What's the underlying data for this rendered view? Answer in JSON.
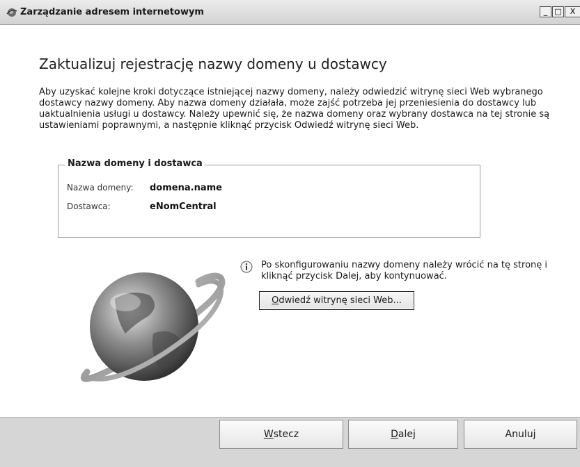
{
  "window": {
    "title": "Zarządzanie adresem internetowym",
    "controls": {
      "minimize": "_",
      "maximize": "□",
      "close": "X"
    }
  },
  "main": {
    "heading": "Zaktualizuj rejestrację nazwy domeny u dostawcy",
    "description": "Aby uzyskać kolejne kroki dotyczące istniejącej nazwy domeny, należy odwiedzić witrynę sieci Web wybranego dostawcy nazwy domeny. Aby nazwa domeny działała, może zajść potrzeba jej przeniesienia do dostawcy lub uaktualnienia usługi u dostawcy. Należy upewnić się, że nazwa domeny oraz wybrany dostawca na tej stronie są ustawieniami poprawnymi, a następnie kliknąć przycisk Odwiedź witrynę sieci Web."
  },
  "group": {
    "legend": "Nazwa domeny i dostawca",
    "domain_label": "Nazwa domeny:",
    "domain_value": "domena.name",
    "provider_label": "Dostawca:",
    "provider_value": "eNomCentral"
  },
  "info": {
    "icon": "info-icon",
    "text": "Po skonfigurowaniu nazwy domeny należy wrócić na tę stronę i kliknąć przycisk Dalej, aby kontynuować.",
    "visit_button": {
      "accel": "O",
      "rest": "dwiedź witrynę sieci Web..."
    }
  },
  "footer": {
    "back": {
      "accel": "W",
      "rest": "stecz"
    },
    "next": {
      "accel": "D",
      "rest": "alej"
    },
    "cancel": "Anuluj"
  },
  "colors": {
    "titlebar": "#d8d8d8",
    "footer": "#d6d6d6"
  }
}
